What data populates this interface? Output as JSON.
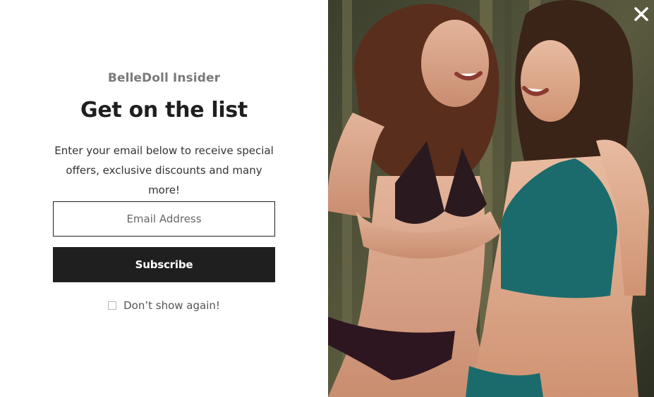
{
  "popup": {
    "brand": "BelleDoll Insider",
    "headline": "Get on the list",
    "description": "Enter your email below to receive special offers, exclusive discounts and many more!",
    "email_placeholder": "Email Address",
    "subscribe_label": "Subscribe",
    "dont_show_label": "Don’t show again!",
    "dont_show_checked": false,
    "close_icon": "close-icon",
    "colors": {
      "button_bg": "#1f1f1f",
      "button_text": "#ffffff",
      "brand_text": "#7a7a7a",
      "headline_text": "#1f1f1f"
    }
  }
}
